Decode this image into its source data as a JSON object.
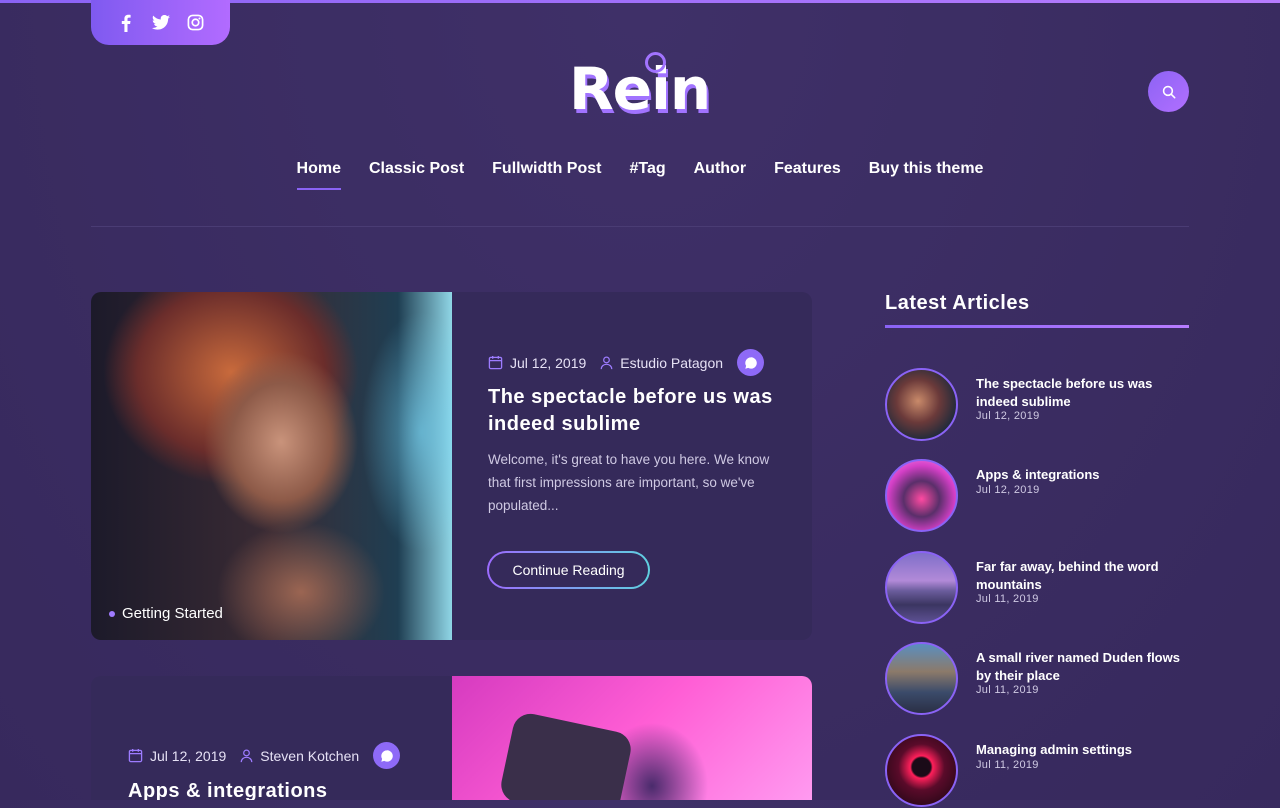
{
  "header": {
    "logo": "Rein",
    "social": [
      {
        "name": "facebook-icon"
      },
      {
        "name": "twitter-icon"
      },
      {
        "name": "instagram-icon"
      }
    ],
    "search_icon": "search-icon"
  },
  "nav": {
    "items": [
      "Home",
      "Classic Post",
      "Fullwidth Post",
      "#Tag",
      "Author",
      "Features",
      "Buy this theme"
    ],
    "active": "Home"
  },
  "posts": [
    {
      "date": "Jul 12, 2019",
      "author": "Estudio Patagon",
      "title": "The spectacle before us was indeed sublime",
      "excerpt": "Welcome, it's great to have you here. We know that first impressions are important, so we've populated...",
      "cta": "Continue Reading",
      "tag": "Getting Started"
    },
    {
      "date": "Jul 12, 2019",
      "author": "Steven Kotchen",
      "title": "Apps & integrations"
    }
  ],
  "sidebar": {
    "heading": "Latest Articles",
    "articles": [
      {
        "title": "The spectacle before us was indeed sublime",
        "date": "Jul 12, 2019"
      },
      {
        "title": "Apps & integrations",
        "date": "Jul 12, 2019"
      },
      {
        "title": "Far far away, behind the word mountains",
        "date": "Jul 11, 2019"
      },
      {
        "title": "A small river named Duden flows by their place",
        "date": "Jul 11, 2019"
      },
      {
        "title": "Managing admin settings",
        "date": "Jul 11, 2019"
      }
    ]
  },
  "colors": {
    "background": "#3b2d63",
    "card": "#352a5a",
    "accent": "#8a63f5",
    "accent2": "#b77cff"
  }
}
